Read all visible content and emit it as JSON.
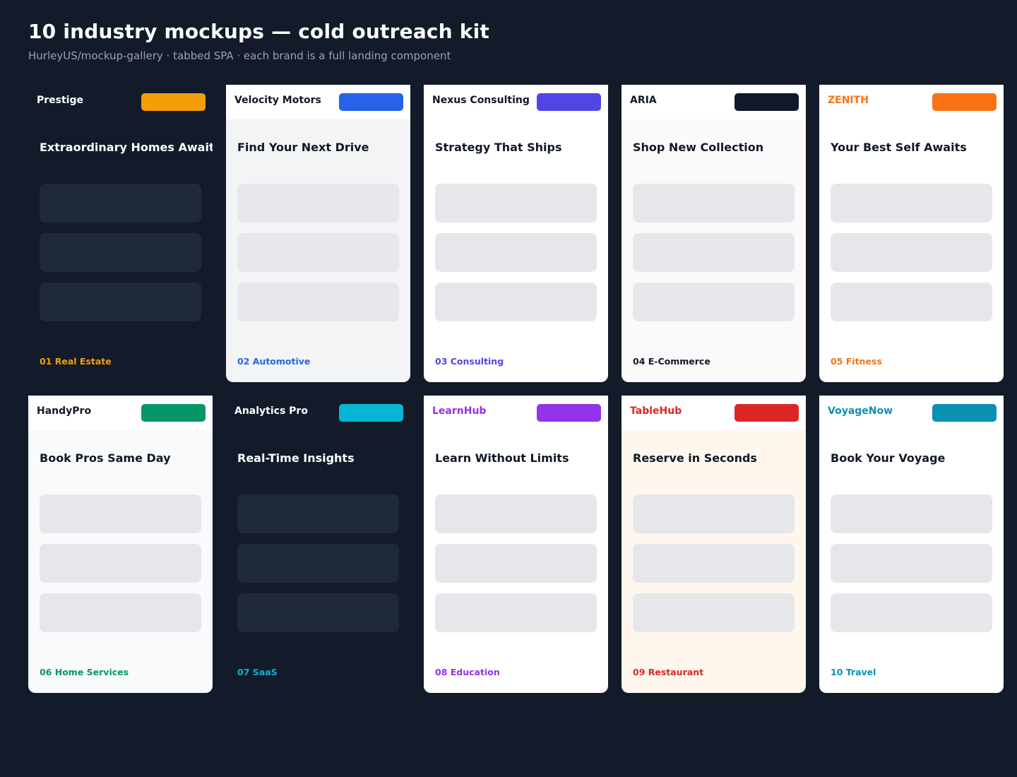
{
  "header": {
    "title": "10 industry mockups — cold outreach kit",
    "subtitle": "HurleyUS/mockup-gallery · tabbed SPA · each brand is a full landing component"
  },
  "cards": [
    {
      "brand": "Prestige",
      "headline": "Extraordinary Homes Await",
      "industry": "01 Real Estate",
      "accent": "#f59e0b",
      "theme": "dark",
      "body_bg": "#131a2a",
      "brand_color": "#ffffff",
      "label_color": "#f59e0b"
    },
    {
      "brand": "Velocity Motors",
      "headline": "Find Your Next Drive",
      "industry": "02 Automotive",
      "accent": "#2563eb",
      "theme": "light",
      "body_bg": "#f3f4f6",
      "brand_color": "#111827",
      "label_color": "#2563eb"
    },
    {
      "brand": "Nexus Consulting",
      "headline": "Strategy That Ships",
      "industry": "03 Consulting",
      "accent": "#4f46e5",
      "theme": "light",
      "body_bg": "#ffffff",
      "brand_color": "#111827",
      "label_color": "#4f46e5"
    },
    {
      "brand": "ARIA",
      "headline": "Shop New Collection",
      "industry": "04 E-Commerce",
      "accent": "#111827",
      "theme": "light",
      "body_bg": "#fafafa",
      "brand_color": "#111827",
      "label_color": "#111827"
    },
    {
      "brand": "ZENITH",
      "headline": "Your Best Self Awaits",
      "industry": "05 Fitness",
      "accent": "#f97316",
      "theme": "light",
      "body_bg": "#ffffff",
      "brand_color": "#f97316",
      "label_color": "#f97316"
    },
    {
      "brand": "HandyPro",
      "headline": "Book Pros Same Day",
      "industry": "06 Home Services",
      "accent": "#059669",
      "theme": "light",
      "body_bg": "#f8fafc",
      "brand_color": "#111827",
      "label_color": "#059669"
    },
    {
      "brand": "Analytics Pro",
      "headline": "Real-Time Insights",
      "industry": "07 SaaS",
      "accent": "#06b6d4",
      "theme": "dark",
      "body_bg": "#131a2a",
      "brand_color": "#ffffff",
      "label_color": "#06b6d4"
    },
    {
      "brand": "LearnHub",
      "headline": "Learn Without Limits",
      "industry": "08 Education",
      "accent": "#9333ea",
      "theme": "light",
      "body_bg": "#ffffff",
      "brand_color": "#9333ea",
      "label_color": "#9333ea"
    },
    {
      "brand": "TableHub",
      "headline": "Reserve in Seconds",
      "industry": "09 Restaurant",
      "accent": "#dc2626",
      "theme": "light",
      "body_bg": "#fff7ed",
      "brand_color": "#dc2626",
      "label_color": "#dc2626"
    },
    {
      "brand": "VoyageNow",
      "headline": "Book Your Voyage",
      "industry": "10 Travel",
      "accent": "#0891b2",
      "theme": "light",
      "body_bg": "#ffffff",
      "brand_color": "#0891b2",
      "label_color": "#0891b2"
    }
  ]
}
